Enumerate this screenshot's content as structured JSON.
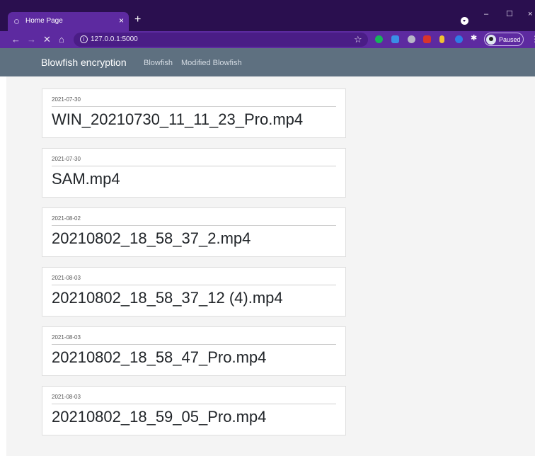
{
  "browser": {
    "tab_title": "Home Page",
    "tab_close": "×",
    "new_tab": "+",
    "url": "127.0.0.1:5000",
    "profile_label": "Paused",
    "window_controls": {
      "minimize": "–",
      "maximize": "☐",
      "close": "×"
    },
    "nav": {
      "back": "←",
      "forward": "→",
      "stop": "✕",
      "home": "⌂"
    },
    "extension_icons": [
      "grammarly-icon",
      "docs-icon",
      "circle-icon",
      "m-icon",
      "yellow-icon",
      "blue-icon",
      "puzzle-icon"
    ],
    "colors": {
      "tabbar": "#2a0f4f",
      "toolbar": "#5d2aa0"
    }
  },
  "navbar": {
    "brand": "Blowfish encryption",
    "links": [
      "Blowfish",
      "Modified Blowfish"
    ],
    "color": "#5e7080"
  },
  "files": [
    {
      "date": "2021-07-30",
      "name": "WIN_20210730_11_11_23_Pro.mp4"
    },
    {
      "date": "2021-07-30",
      "name": "SAM.mp4"
    },
    {
      "date": "2021-08-02",
      "name": "20210802_18_58_37_2.mp4"
    },
    {
      "date": "2021-08-03",
      "name": "20210802_18_58_37_12 (4).mp4"
    },
    {
      "date": "2021-08-03",
      "name": "20210802_18_58_47_Pro.mp4"
    },
    {
      "date": "2021-08-03",
      "name": "20210802_18_59_05_Pro.mp4"
    }
  ]
}
